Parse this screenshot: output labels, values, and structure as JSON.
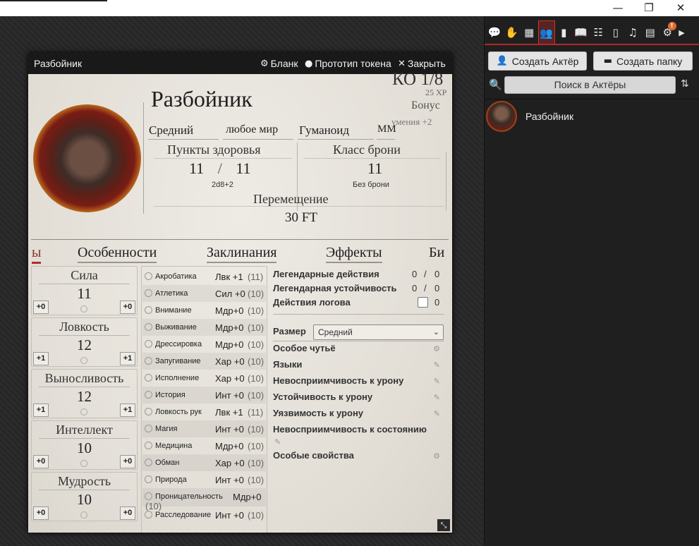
{
  "window": {
    "minimize": "—",
    "restore": "❐",
    "close": "✕"
  },
  "sheet": {
    "title": "Разбойник",
    "controls": {
      "sheet": "Бланк",
      "token": "Прототип токена",
      "close": "Закрыть"
    },
    "name": "Разбойник",
    "ko": "КО 1/8",
    "xp": "25 XP",
    "bonus": "Бонус",
    "bonus_sub": "умения +2",
    "meta": {
      "size": "Средний",
      "alignment": "любое мир",
      "type": "Гуманоид",
      "source": "ММ"
    },
    "hp": {
      "label": "Пункты здоровья",
      "value": "11",
      "max": "11",
      "sep": "/",
      "formula": "2d8+2"
    },
    "ac": {
      "label": "Класс брони",
      "value": "11",
      "sub": "Без брони"
    },
    "movement": {
      "label": "Перемещение",
      "value": "30 FT"
    },
    "tabs": [
      "ы",
      "Особенности",
      "Заклинания",
      "Эффекты",
      "Би"
    ],
    "abilities": [
      {
        "name": "Сила",
        "score": "11",
        "mod": "+0",
        "save": "+0"
      },
      {
        "name": "Ловкость",
        "score": "12",
        "mod": "+1",
        "save": "+1"
      },
      {
        "name": "Выносливость",
        "score": "12",
        "mod": "+1",
        "save": "+1"
      },
      {
        "name": "Интеллект",
        "score": "10",
        "mod": "+0",
        "save": "+0"
      },
      {
        "name": "Мудрость",
        "score": "10",
        "mod": "+0",
        "save": "+0"
      }
    ],
    "skills": [
      {
        "name": "Акробатика",
        "mod": "Лвк +1",
        "passive": "(11)"
      },
      {
        "name": "Атлетика",
        "mod": "Сил +0",
        "passive": "(10)"
      },
      {
        "name": "Внимание",
        "mod": "Мдр+0",
        "passive": "(10)"
      },
      {
        "name": "Выживание",
        "mod": "Мдр+0",
        "passive": "(10)"
      },
      {
        "name": "Дрессировка",
        "mod": "Мдр+0",
        "passive": "(10)"
      },
      {
        "name": "Запугивание",
        "mod": "Хар +0",
        "passive": "(10)"
      },
      {
        "name": "Исполнение",
        "mod": "Хар +0",
        "passive": "(10)"
      },
      {
        "name": "История",
        "mod": "Инт +0",
        "passive": "(10)"
      },
      {
        "name": "Ловкость рук",
        "mod": "Лвк +1",
        "passive": "(11)"
      },
      {
        "name": "Магия",
        "mod": "Инт +0",
        "passive": "(10)"
      },
      {
        "name": "Медицина",
        "mod": "Мдр+0",
        "passive": "(10)"
      },
      {
        "name": "Обман",
        "mod": "Хар +0",
        "passive": "(10)"
      },
      {
        "name": "Природа",
        "mod": "Инт +0",
        "passive": "(10)"
      },
      {
        "name": "Проницательность",
        "mod": "Мдр+0",
        "passive": "(10)"
      },
      {
        "name": "Расследование",
        "mod": "Инт +0",
        "passive": "(10)"
      }
    ],
    "legendary": {
      "actions_label": "Легендарные действия",
      "actions_cur": "0",
      "actions_sep": "/",
      "actions_max": "0",
      "resist_label": "Легендарная устойчивость",
      "resist_cur": "0",
      "resist_sep": "/",
      "resist_max": "0",
      "lair_label": "Действия логова",
      "lair_value": "0"
    },
    "traits": {
      "size_label": "Размер",
      "size_value": "Средний",
      "senses": "Особое чутьё",
      "languages": "Языки",
      "dmg_immunity": "Невосприимчивость к урону",
      "dmg_resistance": "Устойчивость к урону",
      "dmg_vulnerability": "Уязвимость к урону",
      "cond_immunity": "Невосприимчивость к состоянию",
      "special": "Особые свойства"
    }
  },
  "sidebar": {
    "tab_icons": [
      "chat-icon",
      "combat-icon",
      "scenes-icon",
      "actors-icon",
      "items-icon",
      "journal-icon",
      "tables-icon",
      "cards-icon",
      "playlists-icon",
      "compendium-icon",
      "settings-icon"
    ],
    "badge": "!",
    "create_actor": "Создать Актёр",
    "create_folder": "Создать папку",
    "search_placeholder": "Поиск в Актёры",
    "actors": [
      {
        "name": "Разбойник"
      }
    ],
    "accent": "#b32a25"
  }
}
